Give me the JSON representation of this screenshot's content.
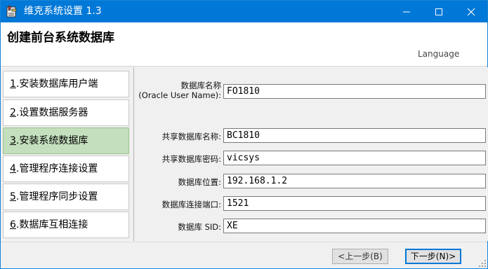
{
  "window": {
    "title": "维克系统设置 1.3",
    "icon": "app-tool-icon",
    "controls": [
      "minimize-icon",
      "maximize-icon",
      "close-icon"
    ],
    "accent_color": "#0078d7"
  },
  "header": {
    "title": "创建前台系统数据库",
    "language_link": "Language"
  },
  "steps": [
    {
      "num": "1",
      "label": ".安装数据库用户端",
      "active": false
    },
    {
      "num": "2",
      "label": ".设置数据服务器",
      "active": false
    },
    {
      "num": "3",
      "label": ".安装系统数据库",
      "active": true
    },
    {
      "num": "4",
      "label": ".管理程序连接设置",
      "active": false
    },
    {
      "num": "5",
      "label": ".管理程序同步设置",
      "active": false
    },
    {
      "num": "6",
      "label": ".数据库互相连接",
      "active": false
    }
  ],
  "active_step_color": "#c4dfbd",
  "form": {
    "db_name_label_1": "数据库名称",
    "db_name_label_2": "(Oracle User Name):",
    "db_name_value": "FO1810",
    "shared_db_name_label": "共享数据库名称:",
    "shared_db_name_value": "BC1810",
    "shared_db_password_label": "共享数据库密码:",
    "shared_db_password_value": "vicsys",
    "db_location_label": "数据库位置:",
    "db_location_value": "192.168.1.2",
    "db_port_label": "数据库连接端口:",
    "db_port_value": "1521",
    "db_sid_label": "数据库 SID:",
    "db_sid_value": "XE"
  },
  "footer": {
    "prev_label": "<上一步(B)",
    "next_label": "下一步(N)>"
  }
}
